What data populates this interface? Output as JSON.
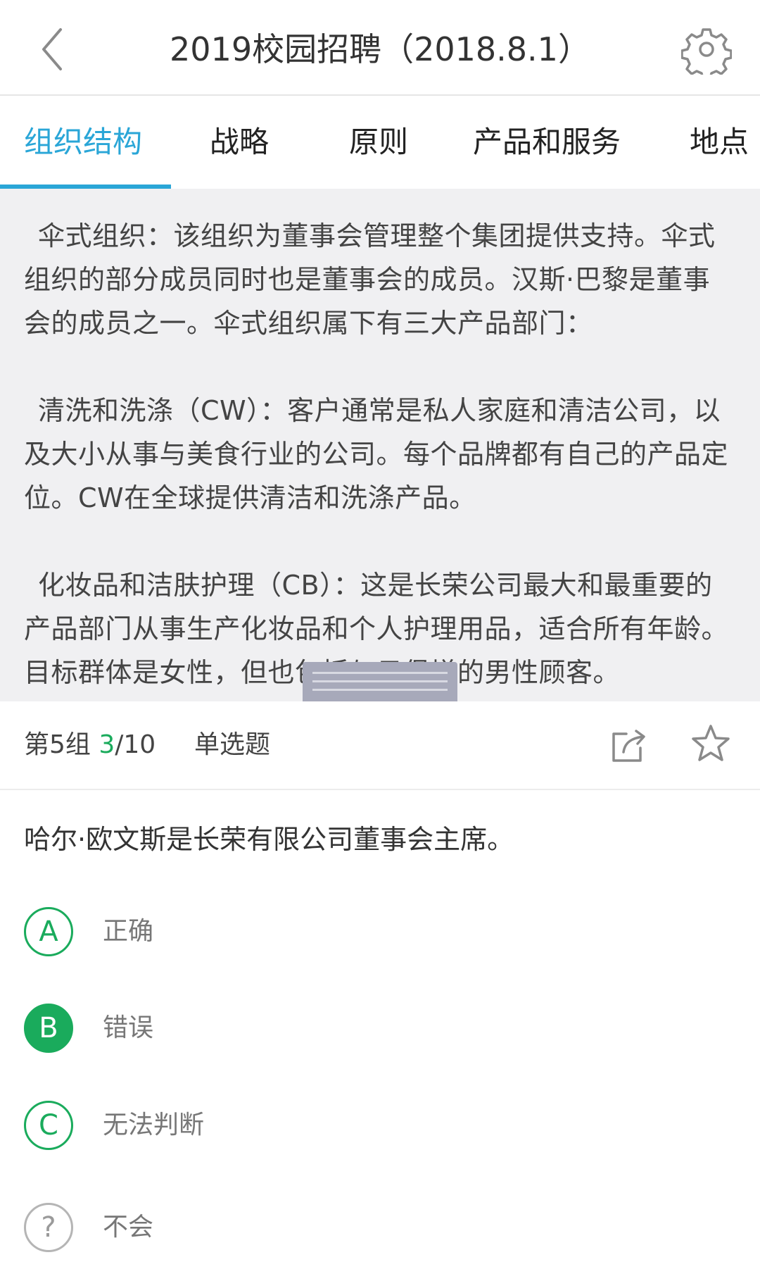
{
  "header": {
    "title": "2019校园招聘（2018.8.1）"
  },
  "tabs": [
    {
      "label": "组织结构",
      "active": true
    },
    {
      "label": "战略",
      "active": false
    },
    {
      "label": "原则",
      "active": false
    },
    {
      "label": "产品和服务",
      "active": false
    },
    {
      "label": "地点",
      "active": false
    }
  ],
  "passage": {
    "paragraphs": [
      "伞式组织：该组织为董事会管理整个集团提供支持。伞式组织的部分成员同时也是董事会的成员。汉斯·巴黎是董事会的成员之一。伞式组织属下有三大产品部门：",
      "清洗和洗涤（CW）：客户通常是私人家庭和清洁公司，以及大小从事与美食行业的公司。每个品牌都有自己的产品定位。CW在全球提供清洁和洗涤产品。",
      "化妆品和洁肤护理（CB）：这是长荣公司最大和最重要的产品部门从事生产化妆品和个人护理用品，适合所有年龄。目标群体是女性，但也包括与日俱增的男性顾客。"
    ]
  },
  "meta": {
    "group": "第5组",
    "current": "3",
    "total": "/10",
    "type": "单选题"
  },
  "question": {
    "text": "哈尔·欧文斯是长荣有限公司董事会主席。",
    "options": [
      {
        "key": "A",
        "label": "正确",
        "selected": false
      },
      {
        "key": "B",
        "label": "错误",
        "selected": true
      },
      {
        "key": "C",
        "label": "无法判断",
        "selected": false
      },
      {
        "key": "?",
        "label": "不会",
        "selected": false
      }
    ]
  },
  "colors": {
    "accent_tab": "#2aa6d7",
    "accent_green": "#1aab5c",
    "passage_bg": "#f0f0f2"
  },
  "icons": {
    "back": "chevron-left-icon",
    "settings": "gear-icon",
    "share": "share-icon",
    "star": "star-icon"
  }
}
